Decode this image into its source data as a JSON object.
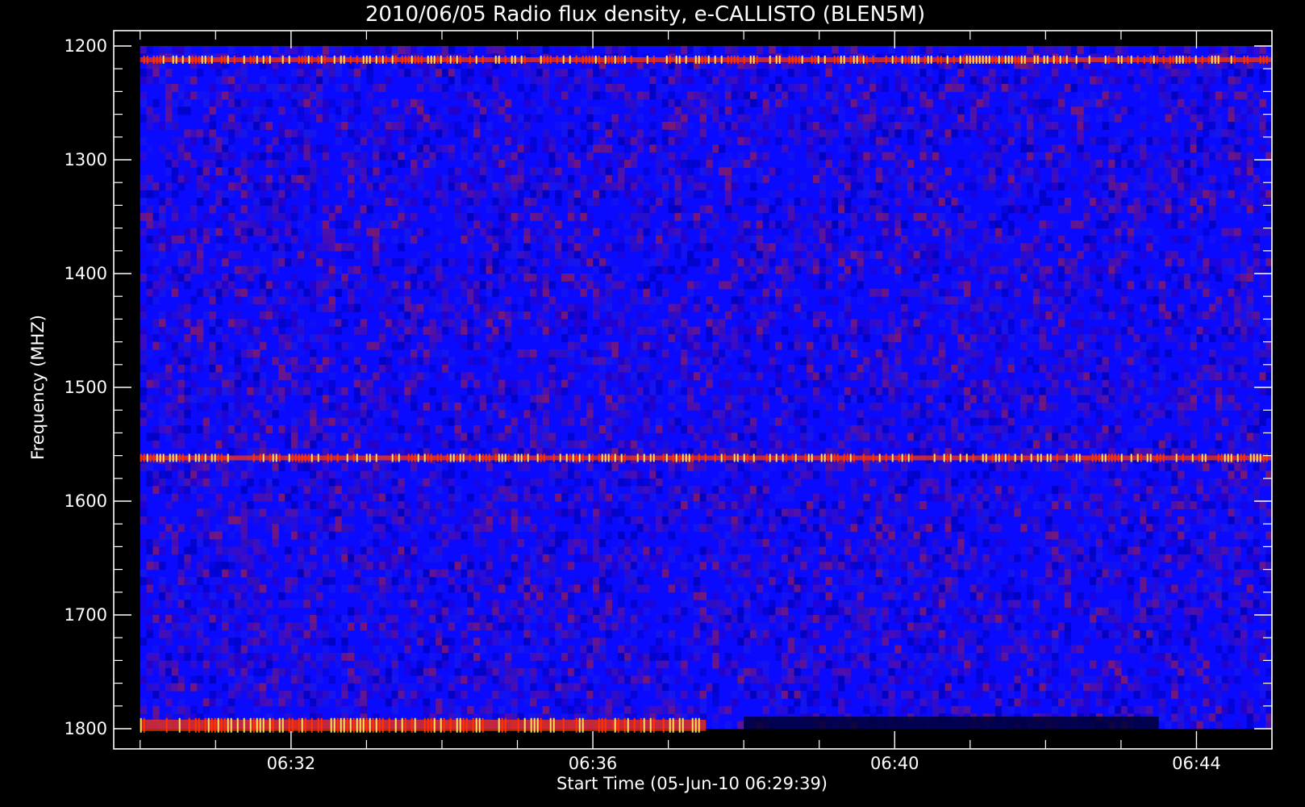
{
  "chart_data": {
    "type": "heatmap",
    "title": "2010/06/05  Radio flux density, e-CALLISTO (BLEN5M)",
    "xlabel": "Start Time (05-Jun-10 06:29:39)",
    "ylabel": "Frequency (MHZ)",
    "y_axis": {
      "range": [
        1200,
        1800
      ],
      "inverted": true,
      "ticks": [
        "1200",
        "1300",
        "1400",
        "1500",
        "1600",
        "1700",
        "1800"
      ],
      "minor_step": 20
    },
    "x_axis": {
      "range": [
        "06:29:39",
        "06:45:00"
      ],
      "ticks": [
        "06:32",
        "06:36",
        "06:40",
        "06:44"
      ],
      "minor_step_minutes": 1
    },
    "data_extent": {
      "time": [
        "06:30:00",
        "06:45:00"
      ],
      "frequency": [
        1200,
        1800
      ]
    },
    "colors": {
      "background": "#000000",
      "low": "#0a0aff",
      "mid": "#8a1a60",
      "high": "#ff3300",
      "peak": "#ffe060"
    },
    "features": [
      {
        "label": "",
        "kind": "band",
        "frequency_mhz": 1212,
        "time": [
          "06:30:00",
          "06:45:00"
        ],
        "intensity": "high"
      },
      {
        "label": "",
        "kind": "band",
        "frequency_mhz": 1562,
        "time": [
          "06:30:00",
          "06:45:00"
        ],
        "intensity": "high"
      },
      {
        "label": "",
        "kind": "band",
        "frequency_mhz": 1797,
        "time": [
          "06:30:00",
          "06:37:30"
        ],
        "intensity": "high"
      },
      {
        "label": "",
        "kind": "dip",
        "frequency_mhz": 1795,
        "time": [
          "06:38:00",
          "06:43:30"
        ],
        "intensity": "low"
      }
    ]
  }
}
